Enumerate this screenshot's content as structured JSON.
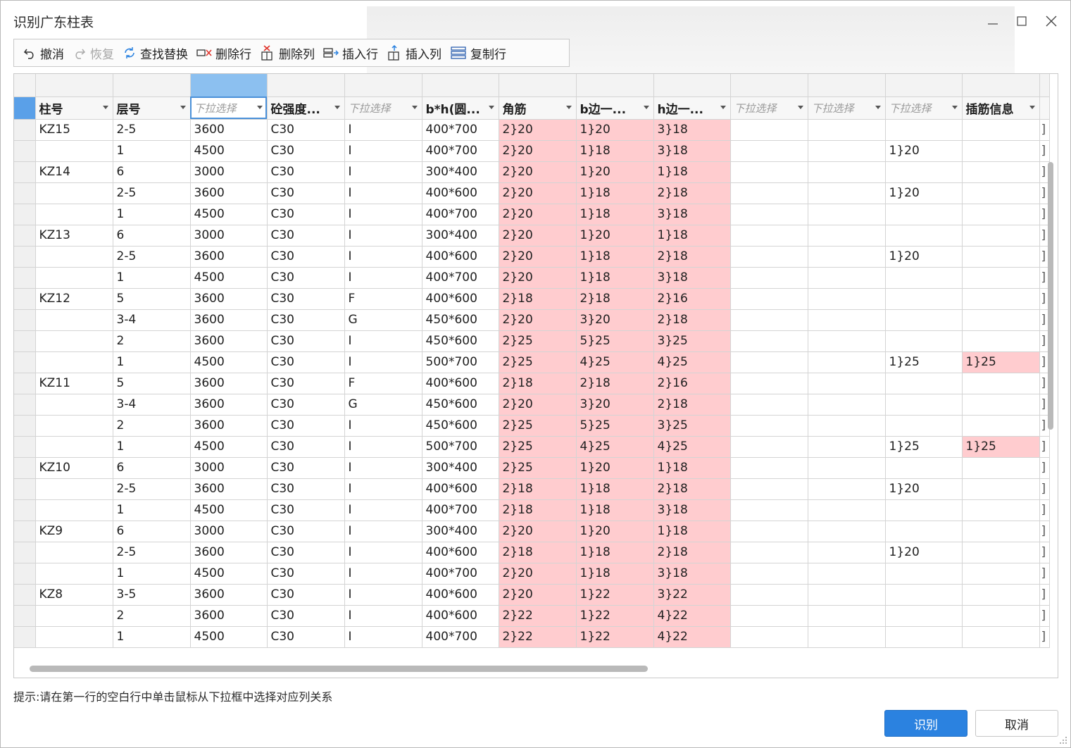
{
  "window": {
    "title": "识别广东柱表"
  },
  "toolbar": {
    "items": [
      {
        "label": "撤消",
        "icon": "undo-icon",
        "enabled": true
      },
      {
        "label": "恢复",
        "icon": "redo-icon",
        "enabled": false
      },
      {
        "label": "查找替换",
        "icon": "find-replace-icon",
        "enabled": true
      },
      {
        "label": "删除行",
        "icon": "delete-row-icon",
        "enabled": true
      },
      {
        "label": "删除列",
        "icon": "delete-column-icon",
        "enabled": true
      },
      {
        "label": "插入行",
        "icon": "insert-row-icon",
        "enabled": true
      },
      {
        "label": "插入列",
        "icon": "insert-column-icon",
        "enabled": true
      },
      {
        "label": "复制行",
        "icon": "copy-row-icon",
        "enabled": true
      }
    ]
  },
  "table": {
    "headers": [
      "柱号",
      "层号",
      "下拉选择",
      "砼强度...",
      "下拉选择",
      "b*h(圆...",
      "角筋",
      "b边一...",
      "h边一...",
      "下拉选择",
      "下拉选择",
      "下拉选择",
      "插筋信息"
    ],
    "placeholder_columns": [
      2,
      4,
      9,
      10,
      11
    ],
    "highlight_columns": [
      6,
      7,
      8
    ],
    "highlight_color": "#ffcccf",
    "selection_color": "#8cc0f0",
    "overflow_glyph": "]",
    "rows": [
      [
        "KZ15",
        "2-5",
        "3600",
        "C30",
        "I",
        "400*700",
        "2}20",
        "1}20",
        "3}18",
        "",
        "",
        "",
        ""
      ],
      [
        "",
        "1",
        "4500",
        "C30",
        "I",
        "400*700",
        "2}20",
        "1}18",
        "3}18",
        "",
        "",
        "1}20",
        ""
      ],
      [
        "KZ14",
        "6",
        "3000",
        "C30",
        "I",
        "300*400",
        "2}20",
        "1}20",
        "1}18",
        "",
        "",
        "",
        ""
      ],
      [
        "",
        "2-5",
        "3600",
        "C30",
        "I",
        "400*600",
        "2}20",
        "1}18",
        "2}18",
        "",
        "",
        "1}20",
        ""
      ],
      [
        "",
        "1",
        "4500",
        "C30",
        "I",
        "400*700",
        "2}20",
        "1}18",
        "3}18",
        "",
        "",
        "",
        ""
      ],
      [
        "KZ13",
        "6",
        "3000",
        "C30",
        "I",
        "300*400",
        "2}20",
        "1}20",
        "1}18",
        "",
        "",
        "",
        ""
      ],
      [
        "",
        "2-5",
        "3600",
        "C30",
        "I",
        "400*600",
        "2}20",
        "1}18",
        "2}18",
        "",
        "",
        "1}20",
        ""
      ],
      [
        "",
        "1",
        "4500",
        "C30",
        "I",
        "400*700",
        "2}20",
        "1}18",
        "3}18",
        "",
        "",
        "",
        ""
      ],
      [
        "KZ12",
        "5",
        "3600",
        "C30",
        "F",
        "400*600",
        "2}18",
        "2}18",
        "2}16",
        "",
        "",
        "",
        ""
      ],
      [
        "",
        "3-4",
        "3600",
        "C30",
        "G",
        "450*600",
        "2}20",
        "3}20",
        "2}18",
        "",
        "",
        "",
        ""
      ],
      [
        "",
        "2",
        "3600",
        "C30",
        "I",
        "450*600",
        "2}25",
        "5}25",
        "3}25",
        "",
        "",
        "",
        ""
      ],
      [
        "",
        "1",
        "4500",
        "C30",
        "I",
        "500*700",
        "2}25",
        "4}25",
        "4}25",
        "",
        "",
        "1}25",
        "1}25"
      ],
      [
        "KZ11",
        "5",
        "3600",
        "C30",
        "F",
        "400*600",
        "2}18",
        "2}18",
        "2}16",
        "",
        "",
        "",
        ""
      ],
      [
        "",
        "3-4",
        "3600",
        "C30",
        "G",
        "450*600",
        "2}20",
        "3}20",
        "2}18",
        "",
        "",
        "",
        ""
      ],
      [
        "",
        "2",
        "3600",
        "C30",
        "I",
        "450*600",
        "2}25",
        "5}25",
        "3}25",
        "",
        "",
        "",
        ""
      ],
      [
        "",
        "1",
        "4500",
        "C30",
        "I",
        "500*700",
        "2}25",
        "4}25",
        "4}25",
        "",
        "",
        "1}25",
        "1}25"
      ],
      [
        "KZ10",
        "6",
        "3000",
        "C30",
        "I",
        "300*400",
        "2}25",
        "1}20",
        "1}18",
        "",
        "",
        "",
        ""
      ],
      [
        "",
        "2-5",
        "3600",
        "C30",
        "I",
        "400*600",
        "2}18",
        "1}18",
        "2}18",
        "",
        "",
        "1}20",
        ""
      ],
      [
        "",
        "1",
        "4500",
        "C30",
        "I",
        "400*700",
        "2}18",
        "1}18",
        "3}18",
        "",
        "",
        "",
        ""
      ],
      [
        "KZ9",
        "6",
        "3000",
        "C30",
        "I",
        "300*400",
        "2}20",
        "1}20",
        "1}18",
        "",
        "",
        "",
        ""
      ],
      [
        "",
        "2-5",
        "3600",
        "C30",
        "I",
        "400*600",
        "2}18",
        "1}18",
        "2}18",
        "",
        "",
        "1}20",
        ""
      ],
      [
        "",
        "1",
        "4500",
        "C30",
        "I",
        "400*700",
        "2}20",
        "1}18",
        "3}18",
        "",
        "",
        "",
        ""
      ],
      [
        "KZ8",
        "3-5",
        "3600",
        "C30",
        "I",
        "400*600",
        "2}20",
        "1}22",
        "3}22",
        "",
        "",
        "",
        ""
      ],
      [
        "",
        "2",
        "3600",
        "C30",
        "I",
        "400*600",
        "2}22",
        "1}22",
        "4}22",
        "",
        "",
        "",
        ""
      ],
      [
        "",
        "1",
        "4500",
        "C30",
        "I",
        "400*700",
        "2}22",
        "1}22",
        "4}22",
        "",
        "",
        "",
        ""
      ]
    ]
  },
  "hint": "提示:请在第一行的空白行中单击鼠标从下拉框中选择对应列关系",
  "buttons": {
    "recognize": "识别",
    "cancel": "取消"
  }
}
